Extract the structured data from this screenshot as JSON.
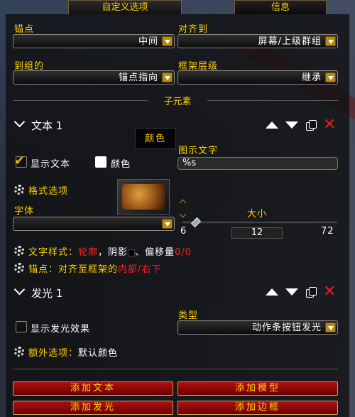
{
  "tabs": {
    "custom_options": "自定义选项",
    "info": "信息"
  },
  "anchor": {
    "label": "锚点",
    "value": "中间"
  },
  "align_to": {
    "label": "对齐到",
    "value": "屏幕/上级群组"
  },
  "to_group": {
    "label": "到组的",
    "value": "锚点指向"
  },
  "frame_strata": {
    "label": "框架层级",
    "value": "继承"
  },
  "sub_elements_title": "子元素",
  "text_element": {
    "header": "文本 1",
    "color_button": "颜色",
    "show_text_label": "显示文本",
    "color_label": "颜色",
    "display_text_label": "图示文字",
    "display_text_value": "%s",
    "format_options_label": "格式选项",
    "font_label": "字体",
    "font_value": "",
    "size_label": "大小",
    "size_min": "6",
    "size_value": "12",
    "size_max": "72",
    "size_fraction": 0.091,
    "style_prefix": "文字样式：",
    "style_outline": "轮廓",
    "style_rest": "，阴影",
    "style_rest2": "、偏移量",
    "style_offset": "0/0",
    "anchor_prefix": "锚点：对齐至框架的",
    "anchor_value": "内部/右下"
  },
  "glow_element": {
    "header": "发光 1",
    "show_glow_label": "显示发光效果",
    "type_label": "类型",
    "type_value": "动作条按钮发光",
    "extra_prefix": "额外选项：",
    "extra_value": "默认颜色"
  },
  "buttons": {
    "add_text": "添加文本",
    "add_model": "添加模型",
    "add_glow": "添加发光",
    "add_border": "添加边框"
  },
  "colors": {
    "gold": "#ffd100",
    "red": "#ff2020",
    "button_red": "#9a0a0a"
  },
  "icons": [
    "chevron-down-icon",
    "move-up-icon",
    "move-down-icon",
    "duplicate-icon",
    "delete-icon",
    "gear-icon",
    "checkmark-icon",
    "dropdown-arrow-icon"
  ]
}
